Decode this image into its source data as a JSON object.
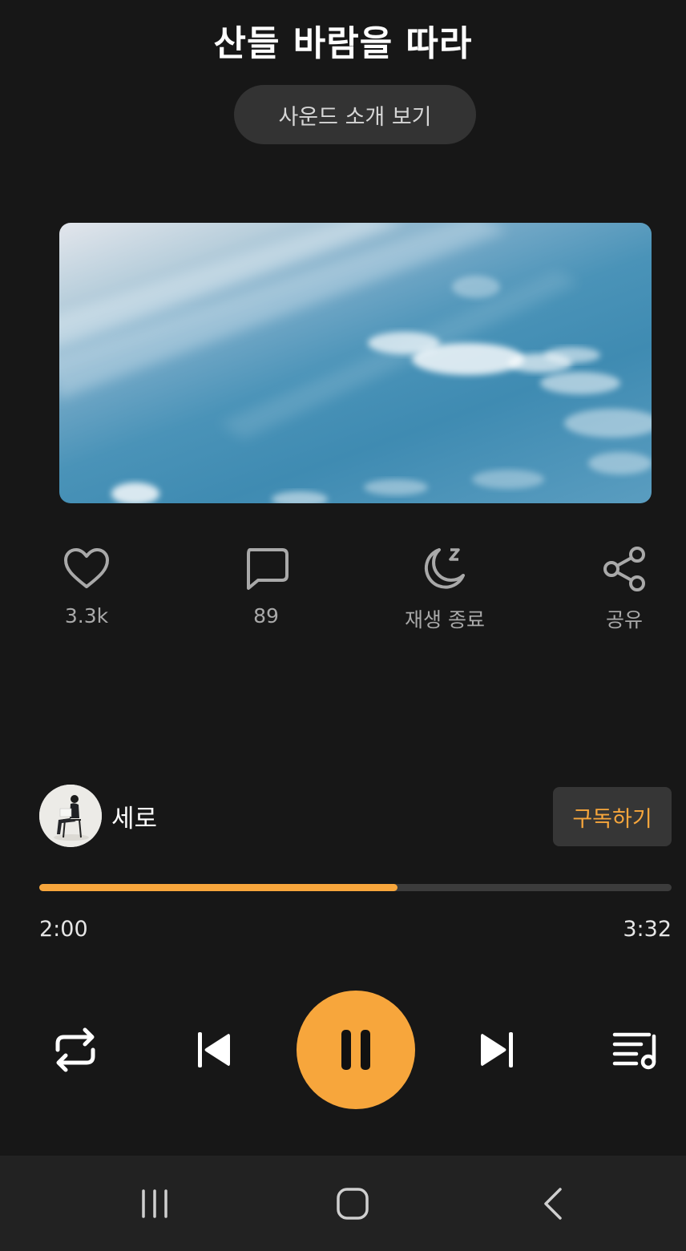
{
  "header": {
    "title": "산들 바람을 따라",
    "intro_button": "사운드 소개 보기"
  },
  "actions": [
    {
      "icon": "heart-icon",
      "label": "3.3k"
    },
    {
      "icon": "comment-icon",
      "label": "89"
    },
    {
      "icon": "sleep-timer-icon",
      "label": "재생 종료"
    },
    {
      "icon": "share-icon",
      "label": "공유"
    }
  ],
  "artist": {
    "name": "세로",
    "subscribe_label": "구독하기"
  },
  "player": {
    "elapsed": "2:00",
    "duration": "3:32",
    "progress_percent": 56.6,
    "state": "playing"
  },
  "controls": [
    "repeat-icon",
    "previous-icon",
    "pause-icon",
    "next-icon",
    "playlist-icon"
  ],
  "system_nav": [
    "recent-apps-icon",
    "home-icon",
    "back-icon"
  ],
  "colors": {
    "accent": "#f7a63c",
    "background": "#171717",
    "nav_background": "#222222"
  }
}
